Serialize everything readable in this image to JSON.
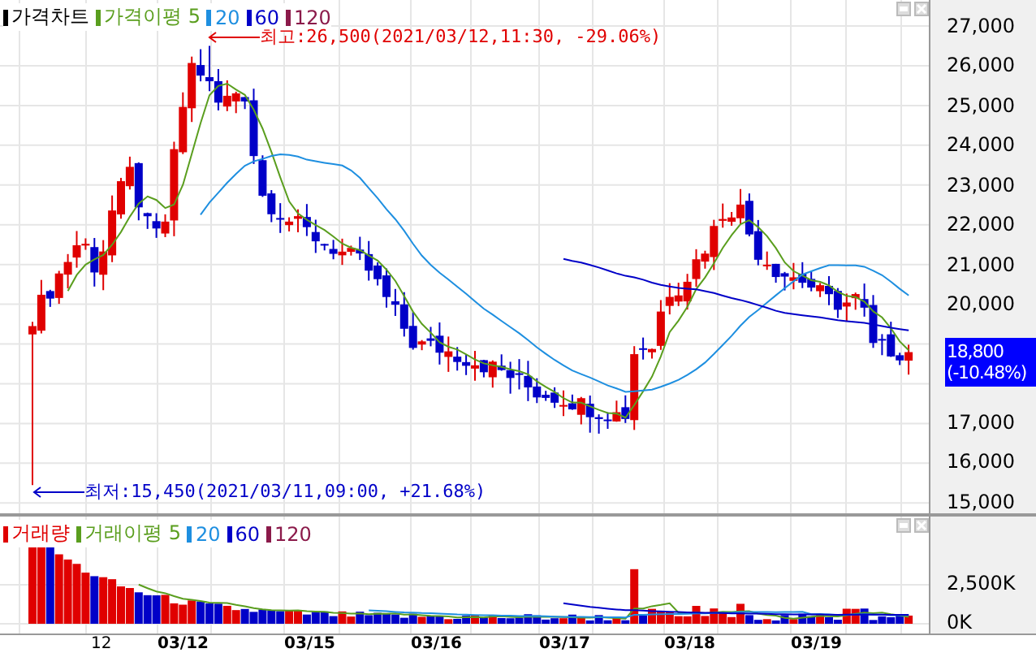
{
  "price_panel": {
    "legend": [
      {
        "label": "가격차트",
        "color": "#000000"
      },
      {
        "label": "가격이평 5",
        "color": "#5a9e1e"
      },
      {
        "label": "20",
        "color": "#1e8fe0"
      },
      {
        "label": "60",
        "color": "#0000c8"
      },
      {
        "label": "120",
        "color": "#8b1a4a"
      }
    ],
    "high_marker": "최고:26,500(2021/03/12,11:30, -29.06%)",
    "low_marker": "최저:15,450(2021/03/11,09:00, +21.68%)",
    "axis": {
      "upper_ticks": [
        "27,000",
        "26,000",
        "25,000",
        "24,000",
        "23,000",
        "22,000",
        "21,000",
        "20,000"
      ],
      "current_price": {
        "price": "18,800",
        "change": "(-10.48%)"
      },
      "lower_ticks": [
        "17,000",
        "16,000",
        "15,000"
      ]
    }
  },
  "volume_panel": {
    "legend": [
      {
        "label": "거래량",
        "color": "#e00000"
      },
      {
        "label": "거래이평 5",
        "color": "#5a9e1e"
      },
      {
        "label": "20",
        "color": "#1e8fe0"
      },
      {
        "label": "60",
        "color": "#0000c8"
      },
      {
        "label": "120",
        "color": "#8b1a4a"
      }
    ],
    "axis": {
      "ticks": [
        "2,500K",
        "0K"
      ]
    }
  },
  "date_axis": [
    {
      "label": "12",
      "bold": false
    },
    {
      "label": "03/12",
      "bold": true
    },
    {
      "label": "03/15",
      "bold": true
    },
    {
      "label": "03/16",
      "bold": true
    },
    {
      "label": "03/17",
      "bold": true
    },
    {
      "label": "03/18",
      "bold": true
    },
    {
      "label": "03/19",
      "bold": true
    }
  ]
}
